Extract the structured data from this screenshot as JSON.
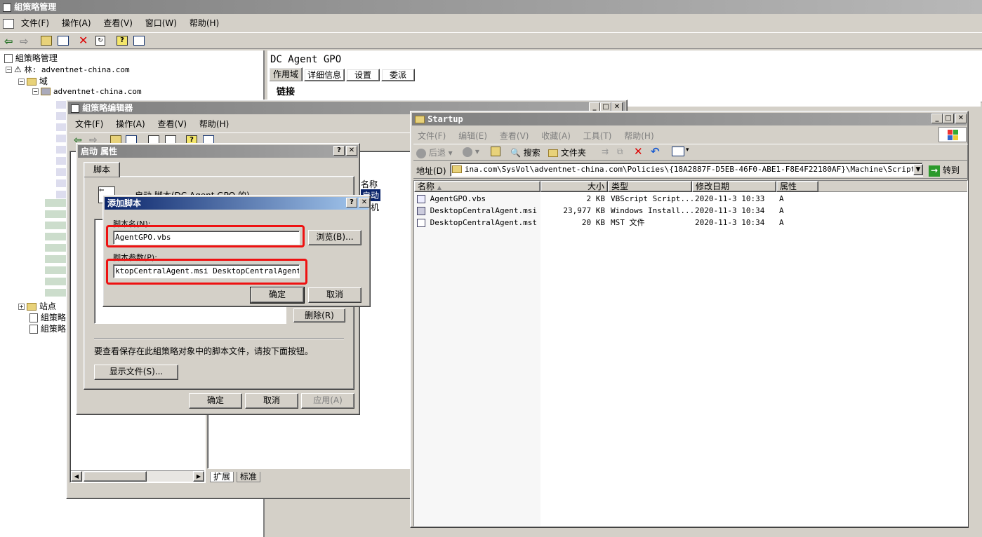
{
  "main_window": {
    "title": "組策略管理",
    "menu": [
      "文件(F)",
      "操作(A)",
      "查看(V)",
      "窗口(W)",
      "帮助(H)"
    ],
    "tree": {
      "root": "組策略管理",
      "forest": "林: adventnet-china.com",
      "domains": "域",
      "domain": "adventnet-china.com",
      "sites": "站点",
      "item1": "組策略",
      "item2": "組策略"
    },
    "right_pane": {
      "title": "DC Agent GPO",
      "tabs": [
        "作用域",
        "详细信息",
        "设置",
        "委派"
      ],
      "section": "链接"
    }
  },
  "gpo_editor": {
    "title": "組策略编辑器",
    "menu": [
      "文件(F)",
      "操作(A)",
      "查看(V)",
      "帮助(H)"
    ],
    "list_header": "名称",
    "list_items": [
      "启动",
      "关机"
    ],
    "bottom_tabs": [
      "扩展",
      "标准"
    ]
  },
  "startup_props": {
    "title": "启动 属性",
    "tab": "脚本",
    "description": "启动 脚本(DC Agent GPO 的)",
    "remove_button": "删除(R)",
    "info_text": "要查看保存在此組策略对象中的脚本文件，请按下面按钮。",
    "show_files_button": "显示文件(S)...",
    "ok": "确定",
    "cancel": "取消",
    "apply": "应用(A)"
  },
  "add_script": {
    "title": "添加脚本",
    "name_label": "脚本名(N):",
    "name_value": "AgentGPO.vbs",
    "browse": "浏览(B)...",
    "params_label": "脚本参数(P):",
    "params_value": "ktopCentralAgent.msi DesktopCentralAgent.mst",
    "ok": "确定",
    "cancel": "取消"
  },
  "explorer": {
    "title": "Startup",
    "menu": [
      "文件(F)",
      "编辑(E)",
      "查看(V)",
      "收藏(A)",
      "工具(T)",
      "帮助(H)"
    ],
    "toolbar": {
      "back": "后退",
      "search": "搜索",
      "folders": "文件夹"
    },
    "address_label": "地址(D)",
    "address": "ina.com\\SysVol\\adventnet-china.com\\Policies\\{18A2887F-D5EB-46F0-ABE1-F8E4F22180AF}\\Machine\\Scripts\\Startup",
    "go": "转到",
    "columns": [
      "名称",
      "大小",
      "类型",
      "修改日期",
      "属性"
    ],
    "files": [
      {
        "name": "AgentGPO.vbs",
        "size": "2 KB",
        "type": "VBScript Script...",
        "date": "2020-11-3 10:33",
        "attr": "A"
      },
      {
        "name": "DesktopCentralAgent.msi",
        "size": "23,977 KB",
        "type": "Windows Install...",
        "date": "2020-11-3 10:34",
        "attr": "A"
      },
      {
        "name": "DesktopCentralAgent.mst",
        "size": "20 KB",
        "type": "MST 文件",
        "date": "2020-11-3 10:34",
        "attr": "A"
      }
    ]
  },
  "colors": {
    "highlight": "#ee1111",
    "active_title": "#0a246a",
    "face": "#d4d0c8"
  }
}
